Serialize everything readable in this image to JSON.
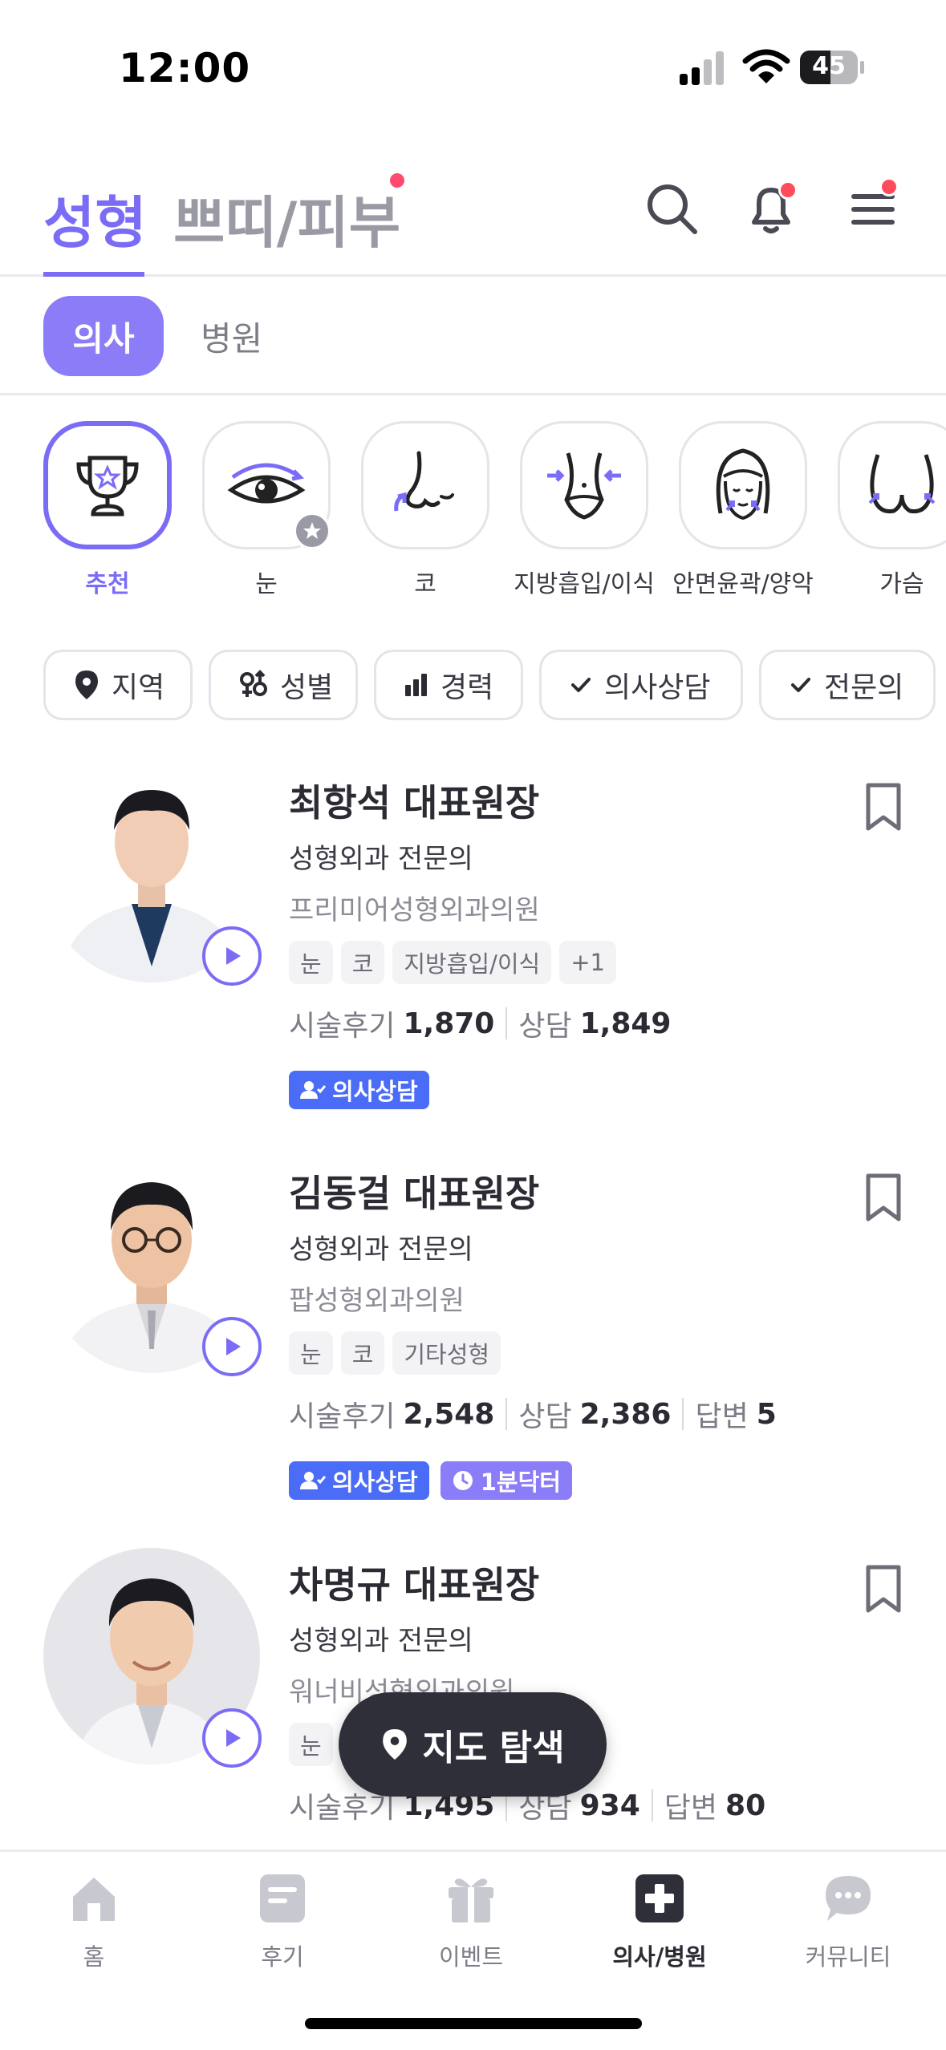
{
  "status_bar": {
    "time": "12:00",
    "battery": "45"
  },
  "top_tabs": [
    {
      "label": "성형",
      "active": true
    },
    {
      "label": "쁘띠/피부",
      "active": false
    }
  ],
  "sub_tabs": [
    {
      "label": "의사",
      "active": true
    },
    {
      "label": "병원",
      "active": false
    }
  ],
  "categories": [
    {
      "label": "추천",
      "icon": "trophy-icon"
    },
    {
      "label": "눈",
      "icon": "eye-icon"
    },
    {
      "label": "코",
      "icon": "nose-icon"
    },
    {
      "label": "지방흡입/이식",
      "icon": "waist-icon"
    },
    {
      "label": "안면윤곽/양악",
      "icon": "face-icon"
    },
    {
      "label": "가슴",
      "icon": "chest-icon"
    }
  ],
  "filters": [
    {
      "label": "지역",
      "icon": "location-pin-icon"
    },
    {
      "label": "성별",
      "icon": "gender-icon"
    },
    {
      "label": "경력",
      "icon": "bar-chart-icon"
    },
    {
      "label": "의사상담",
      "icon": "check-icon"
    },
    {
      "label": "전문의",
      "icon": "check-icon"
    }
  ],
  "doctors": [
    {
      "name": "최항석 대표원장",
      "specialty": "성형외과 전문의",
      "hospital": "프리미어성형외과의원",
      "tags": [
        "눈",
        "코",
        "지방흡입/이식",
        "+1"
      ],
      "stats": [
        {
          "label": "시술후기",
          "value": "1,870"
        },
        {
          "label": "상담",
          "value": "1,849"
        }
      ],
      "badges": [
        {
          "label": "의사상담",
          "style": "blue"
        }
      ]
    },
    {
      "name": "김동걸 대표원장",
      "specialty": "성형외과 전문의",
      "hospital": "팝성형외과의원",
      "tags": [
        "눈",
        "코",
        "기타성형"
      ],
      "stats": [
        {
          "label": "시술후기",
          "value": "2,548"
        },
        {
          "label": "상담",
          "value": "2,386"
        },
        {
          "label": "답변",
          "value": "5"
        }
      ],
      "badges": [
        {
          "label": "의사상담",
          "style": "blue"
        },
        {
          "label": "1분닥터",
          "style": "purple"
        }
      ]
    },
    {
      "name": "차명규 대표원장",
      "specialty": "성형외과 전문의",
      "hospital": "워너비성형외과의원",
      "tags": [
        "눈"
      ],
      "stats": [
        {
          "label": "시술후기",
          "value": "1,495"
        },
        {
          "label": "상담",
          "value": "934"
        },
        {
          "label": "답변",
          "value": "80"
        }
      ],
      "badges": []
    }
  ],
  "map_button": {
    "label": "지도 탐색"
  },
  "bottom_nav": [
    {
      "label": "홈",
      "icon": "home-icon"
    },
    {
      "label": "후기",
      "icon": "review-icon"
    },
    {
      "label": "이벤트",
      "icon": "gift-icon"
    },
    {
      "label": "의사/병원",
      "icon": "medical-plus-icon",
      "active": true
    },
    {
      "label": "커뮤니티",
      "icon": "chat-bubble-icon"
    }
  ],
  "colors": {
    "accent": "#7b6cf6",
    "badge_blue": "#4a6cf7",
    "badge_purple": "#8b7cf8",
    "dark": "#2f2f3a",
    "notification": "#ff4b5c"
  }
}
